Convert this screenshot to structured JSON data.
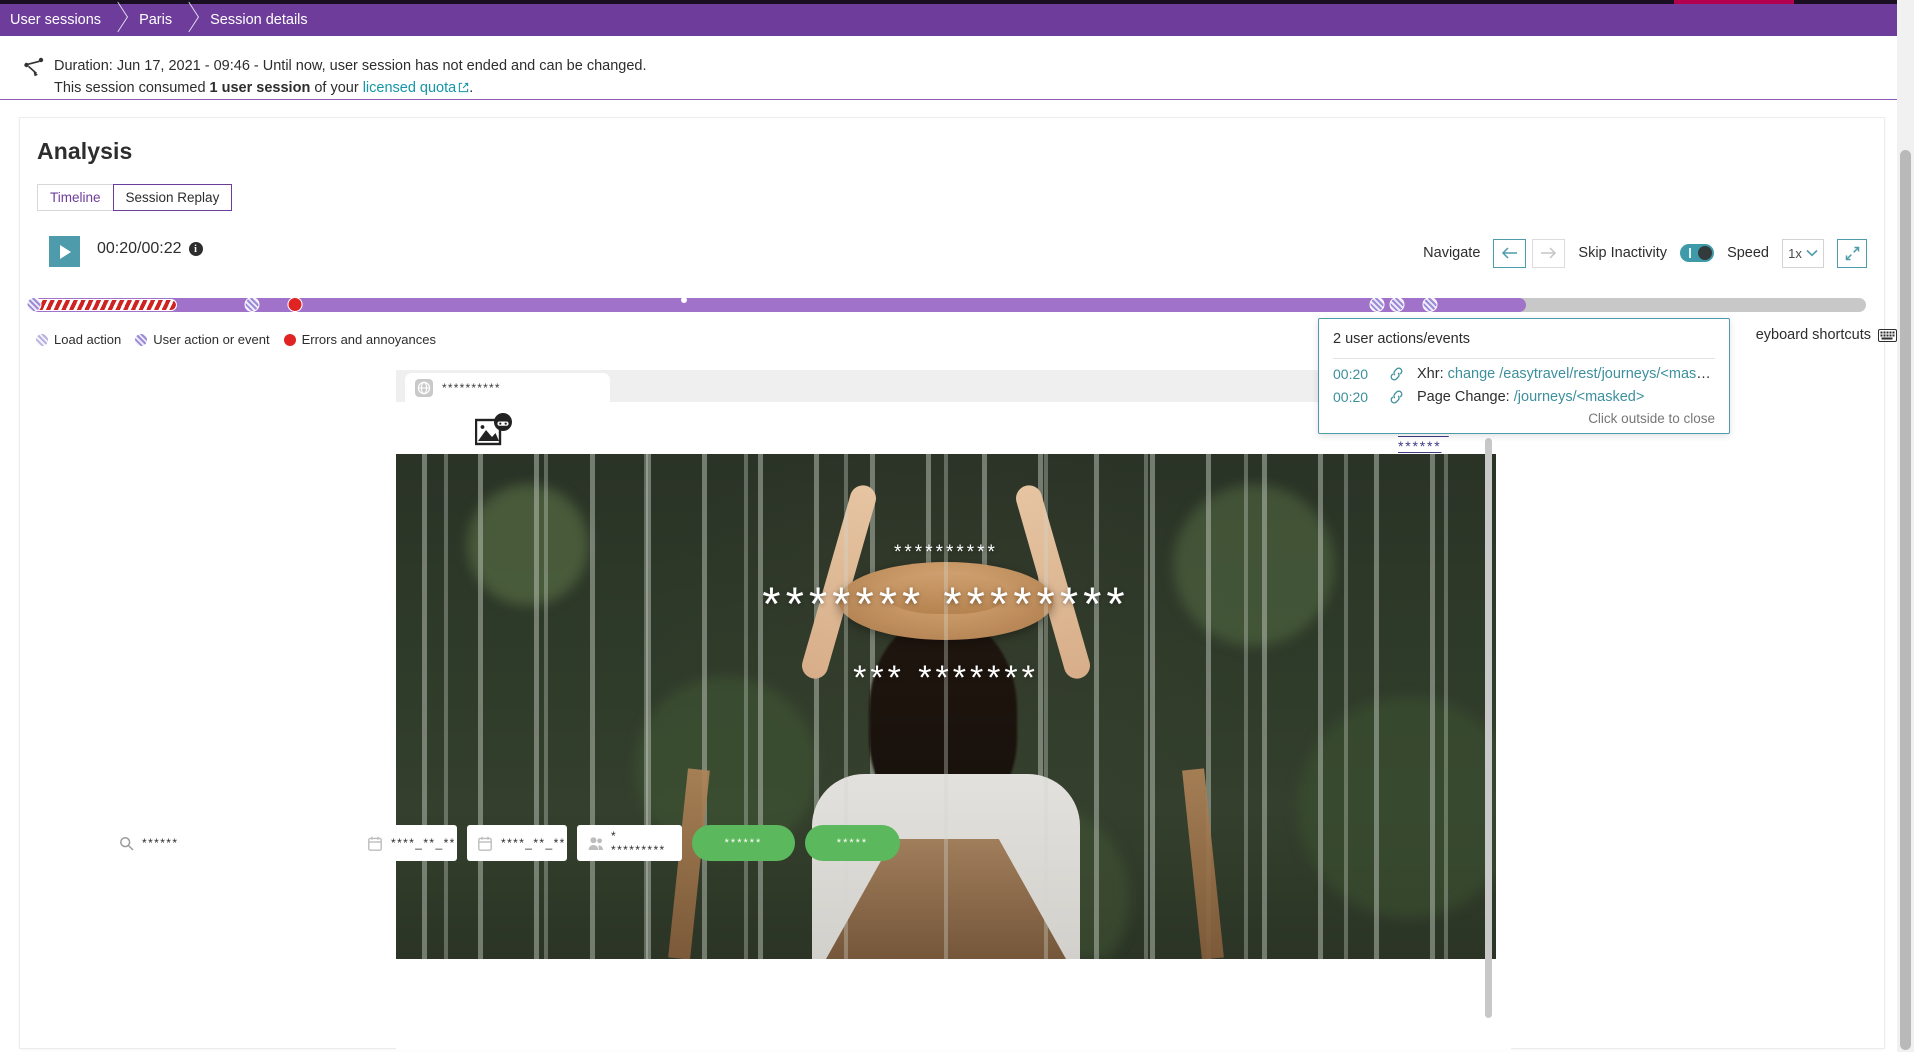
{
  "breadcrumb": {
    "items": [
      {
        "label": "User sessions"
      },
      {
        "label": "Paris"
      },
      {
        "label": "Session details"
      }
    ]
  },
  "info": {
    "icon": "user-session-path-icon",
    "duration_line": "Duration: Jun 17, 2021 - 09:46 - Until now, user session has not ended and can be changed.",
    "consumed_prefix": "This session consumed ",
    "consumed_bold": "1 user session",
    "consumed_mid": " of your ",
    "quota_link": "licensed quota",
    "consumed_suffix": "."
  },
  "page": {
    "title": "Analysis",
    "tabs": [
      {
        "label": "Timeline",
        "active": false
      },
      {
        "label": "Session Replay",
        "active": true
      }
    ]
  },
  "player": {
    "play_icon": "play-icon",
    "time_current": "00:20",
    "time_total": "00:22",
    "time_display": "00:20/00:22",
    "info_icon": "info-icon",
    "navigate_label": "Navigate",
    "prev_icon": "arrow-left-icon",
    "next_icon": "arrow-right-icon",
    "skip_inactivity_label": "Skip Inactivity",
    "skip_inactivity_on": true,
    "speed_label": "Speed",
    "speed_value": "1x",
    "speed_chevron": "chevron-down-icon",
    "expand_icon": "expand-icon"
  },
  "timeline": {
    "played_percent": 81.5,
    "load_action": {
      "start_percent": 0.3,
      "width_percent": 7.8
    },
    "markers": [
      {
        "type": "action",
        "percent": 0.3
      },
      {
        "type": "action",
        "percent": 12.2
      },
      {
        "type": "action",
        "percent": 14.5
      },
      {
        "type": "error",
        "percent": 14.5
      },
      {
        "type": "action",
        "percent": 73.4
      },
      {
        "type": "action",
        "percent": 74.5
      },
      {
        "type": "action",
        "percent": 76.3
      }
    ],
    "legend": [
      {
        "label": "Load action",
        "swatch": "load"
      },
      {
        "label": "User action or event",
        "swatch": "action"
      },
      {
        "label": "Errors and annoyances",
        "swatch": "error"
      }
    ]
  },
  "shortcuts": {
    "label": "eyboard shortcuts",
    "icon": "keyboard-icon"
  },
  "popup": {
    "title": "2 user actions/events",
    "rows": [
      {
        "time": "00:20",
        "icon": "link-icon",
        "prefix": "Xhr: ",
        "link": "change /easytravel/rest/journeys/<mask..."
      },
      {
        "time": "00:20",
        "icon": "link-icon",
        "prefix": "Page Change: ",
        "link": "/journeys/<masked>"
      }
    ],
    "footer": "Click outside to close"
  },
  "replay": {
    "tab": {
      "icon": "globe-icon",
      "title": "**********"
    },
    "site": {
      "logo_icon": "masked-image-icon",
      "nav": [
        {
          "label": "******* ******"
        },
        {
          "label": "*******"
        }
      ],
      "hero": {
        "line_top": "**********",
        "line_mid": "******* ********",
        "line_bottom": "*** *******"
      },
      "search_form": {
        "destination": {
          "icon": "search-icon",
          "value": "******"
        },
        "date_from": {
          "icon": "calendar-icon",
          "value": "****_**_**"
        },
        "date_to": {
          "icon": "calendar-icon",
          "value": "****_**_**"
        },
        "travellers": {
          "icon": "people-icon",
          "value": "* *********"
        },
        "buttons": [
          {
            "label": "******"
          },
          {
            "label": "*****"
          }
        ]
      }
    }
  },
  "colors": {
    "brand_purple": "#6e3d9b",
    "timeline_played": "#a172c9",
    "teal": "#4e9bab",
    "error_red": "#e02424",
    "green_button": "#5cb85c"
  }
}
